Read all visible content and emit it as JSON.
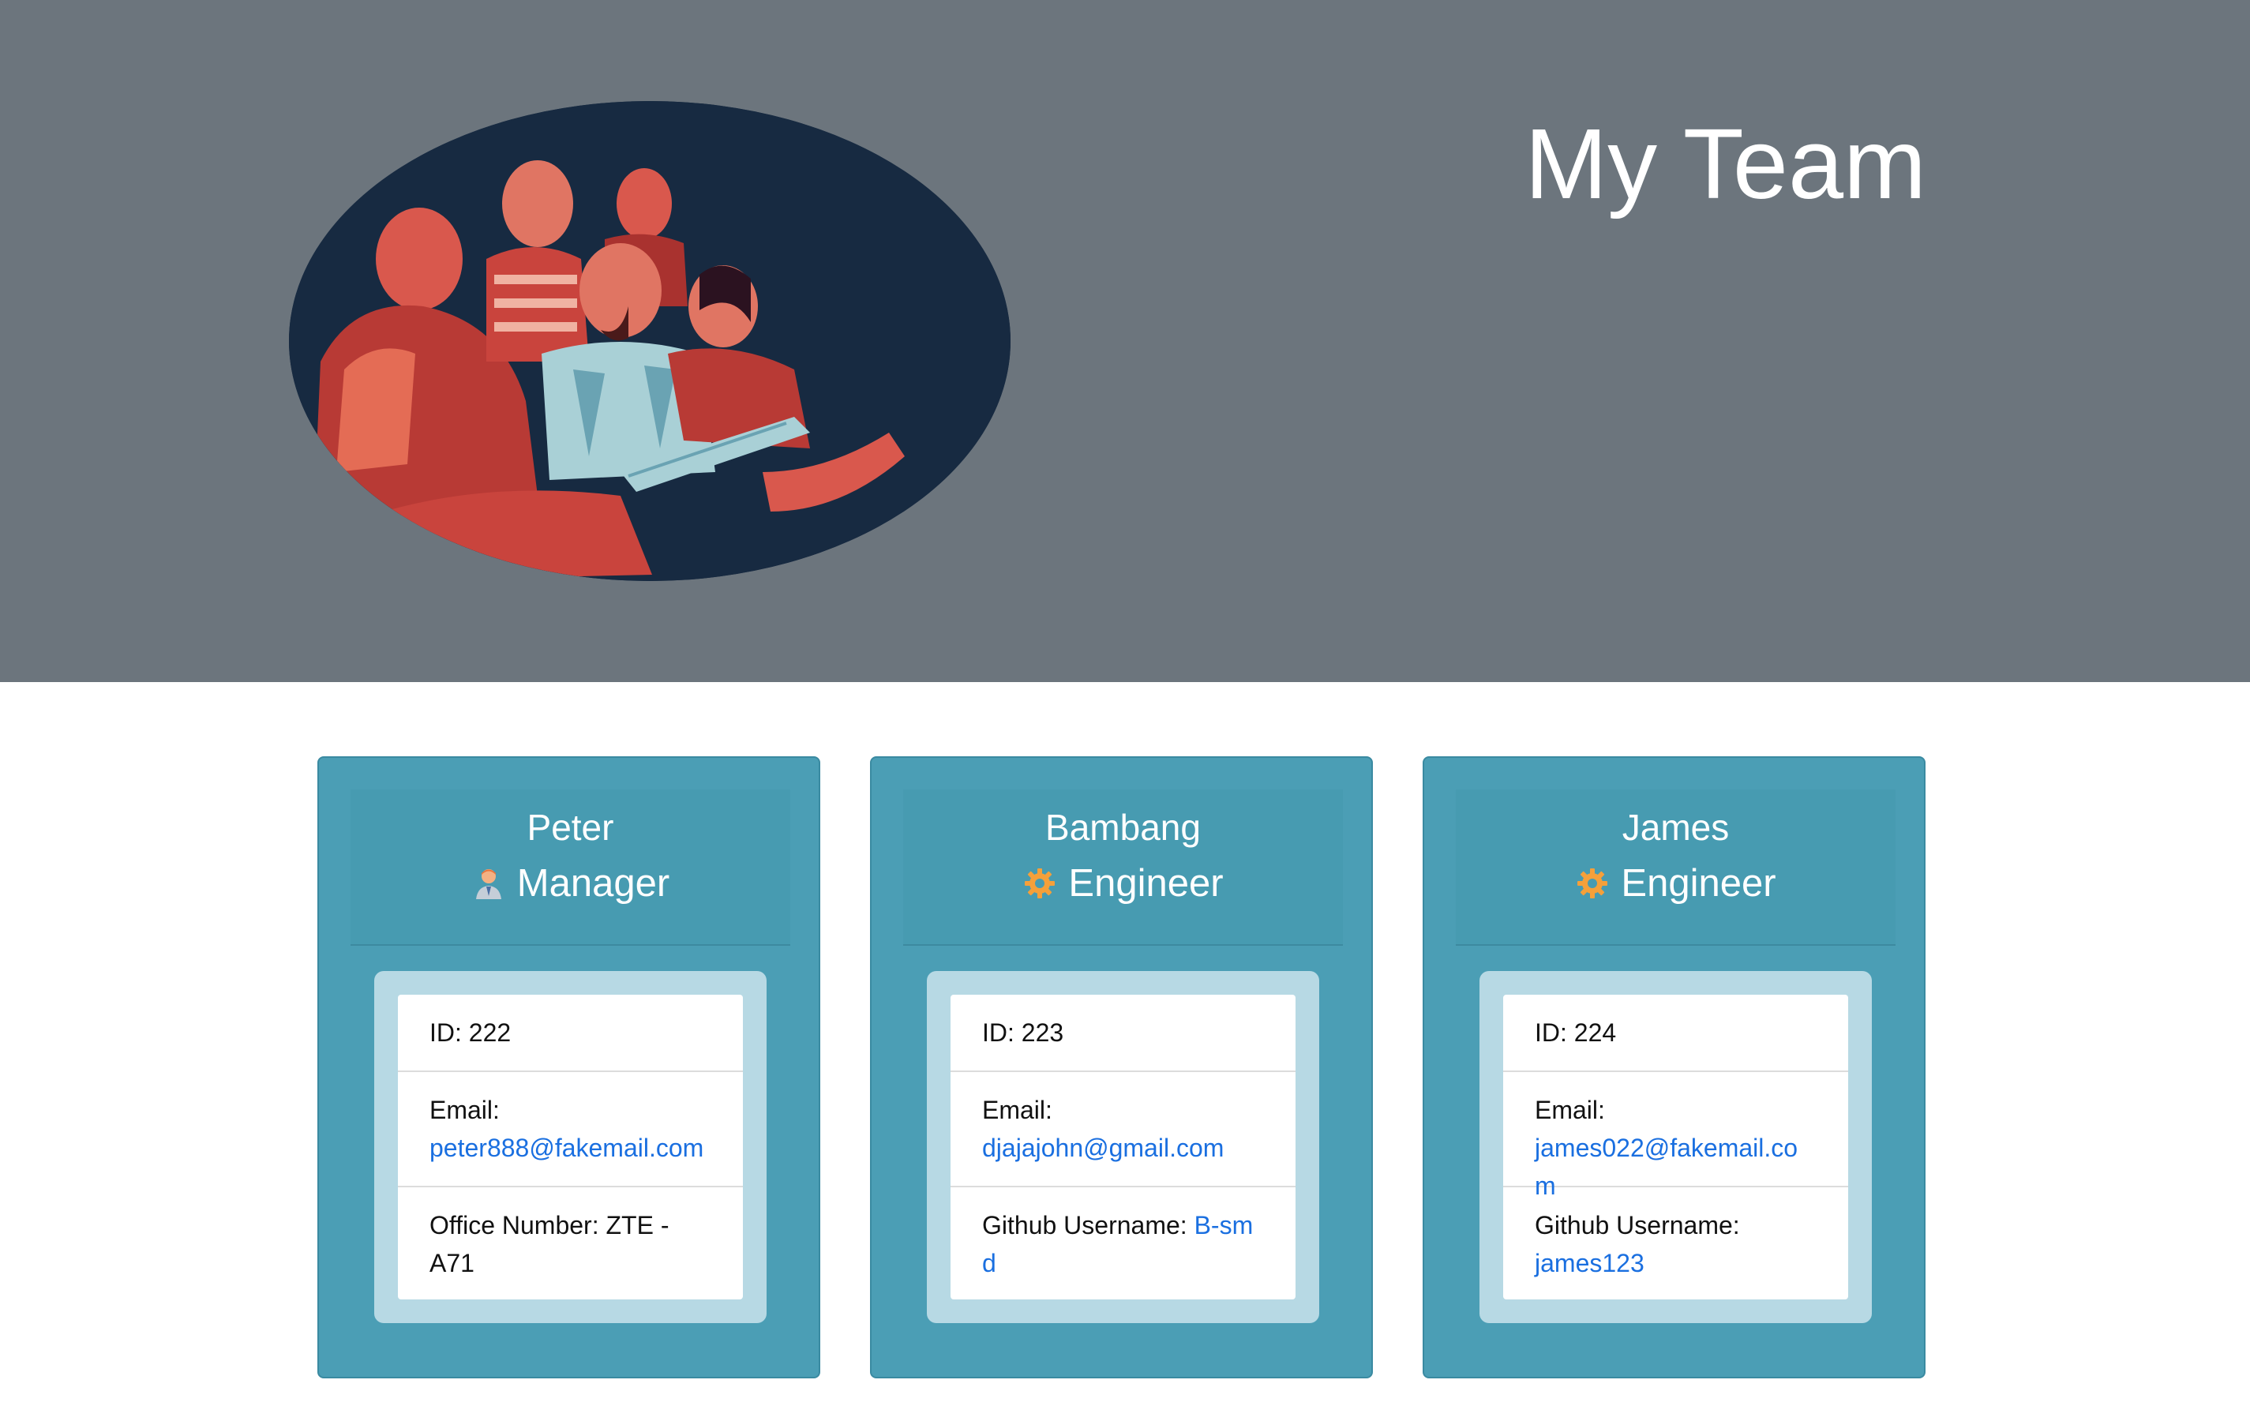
{
  "header": {
    "title": "My Team",
    "photo_icon": "team-photo"
  },
  "colors": {
    "hero_bg": "#6c757d",
    "card_bg": "#4b9eb5",
    "card_body_bg": "#b7d9e4",
    "link": "#1a6fe0",
    "accent_orange": "#f5a03a"
  },
  "cards": [
    {
      "name": "Peter",
      "role": "Manager",
      "role_icon": "manager-icon",
      "id_label": "ID: 222",
      "email_label": "Email:",
      "email": "peter888@fakemail.com",
      "extra_label": "Office Number: ZTE - A71",
      "extra_link": ""
    },
    {
      "name": "Bambang",
      "role": "Engineer",
      "role_icon": "gear-icon",
      "id_label": "ID: 223",
      "email_label": "Email:",
      "email": "djajajohn@gmail.com",
      "extra_label": "Github Username:",
      "extra_link": "B-smd"
    },
    {
      "name": "James",
      "role": "Engineer",
      "role_icon": "gear-icon",
      "id_label": "ID: 224",
      "email_label": "Email:",
      "email": "james022@fakemail.com",
      "extra_label": "Github Username:",
      "extra_link": "james123"
    }
  ]
}
